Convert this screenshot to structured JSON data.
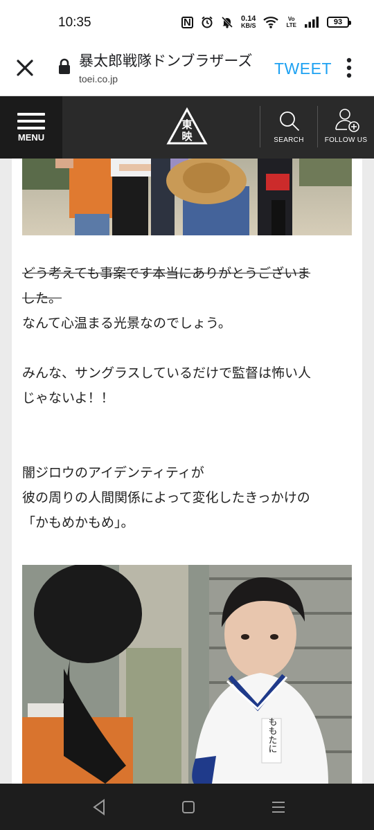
{
  "status_bar": {
    "time": "10:35",
    "nfc": "N",
    "alarm": "⏰",
    "mute": "🔕",
    "speed_value": "0.14",
    "speed_unit": "KB/S",
    "wifi": "wifi-icon",
    "volte_top": "Vo",
    "volte_bottom": "LTE",
    "battery": "93"
  },
  "browser": {
    "title": "暴太郎戦隊ドンブラザーズ",
    "domain": "toei.co.jp",
    "tweet_label": "TWEET"
  },
  "site_header": {
    "menu_label": "MENU",
    "logo_text_top": "東",
    "logo_text_bottom": "映",
    "search_label": "SEARCH",
    "follow_label": "FOLLOW US"
  },
  "article": {
    "strike_line1": "どう考えても事案です本当にありがとうございま",
    "strike_line2": "した。",
    "p1": "なんて心温まる光景なのでしょう。",
    "p2_line1": "みんな、サングラスしているだけで監督は怖い人",
    "p2_line2": "じゃないよ！！",
    "p3_line1": "闇ジロウのアイデンティティが",
    "p3_line2": "彼の周りの人間関係によって変化したきっかけの",
    "p3_line3": "「かもめかもめ」。",
    "name_tag": "ももたに"
  },
  "nav": {
    "back": "◁",
    "home": "▢",
    "recents": "☰"
  },
  "colors": {
    "tweet": "#1da1f2",
    "header_bg": "#2a2a2a",
    "nav_bg": "#1d1d1d"
  }
}
